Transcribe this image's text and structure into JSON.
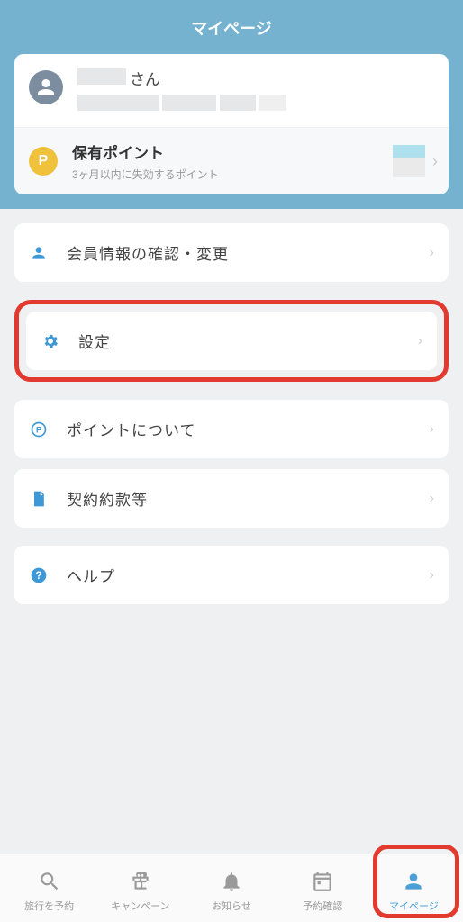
{
  "header": {
    "title": "マイページ"
  },
  "profile": {
    "suffix": "さん",
    "points_label": "保有ポイント",
    "points_sub": "3ヶ月以内に失効するポイント"
  },
  "menu": {
    "member_info": "会員情報の確認・変更",
    "settings": "設定",
    "about_points": "ポイントについて",
    "terms": "契約約款等",
    "help": "ヘルプ"
  },
  "tabs": {
    "reserve": "旅行を予約",
    "campaign": "キャンペーン",
    "notice": "お知らせ",
    "booking": "予約確認",
    "mypage": "マイページ"
  },
  "icons": {
    "points_letter": "P"
  }
}
